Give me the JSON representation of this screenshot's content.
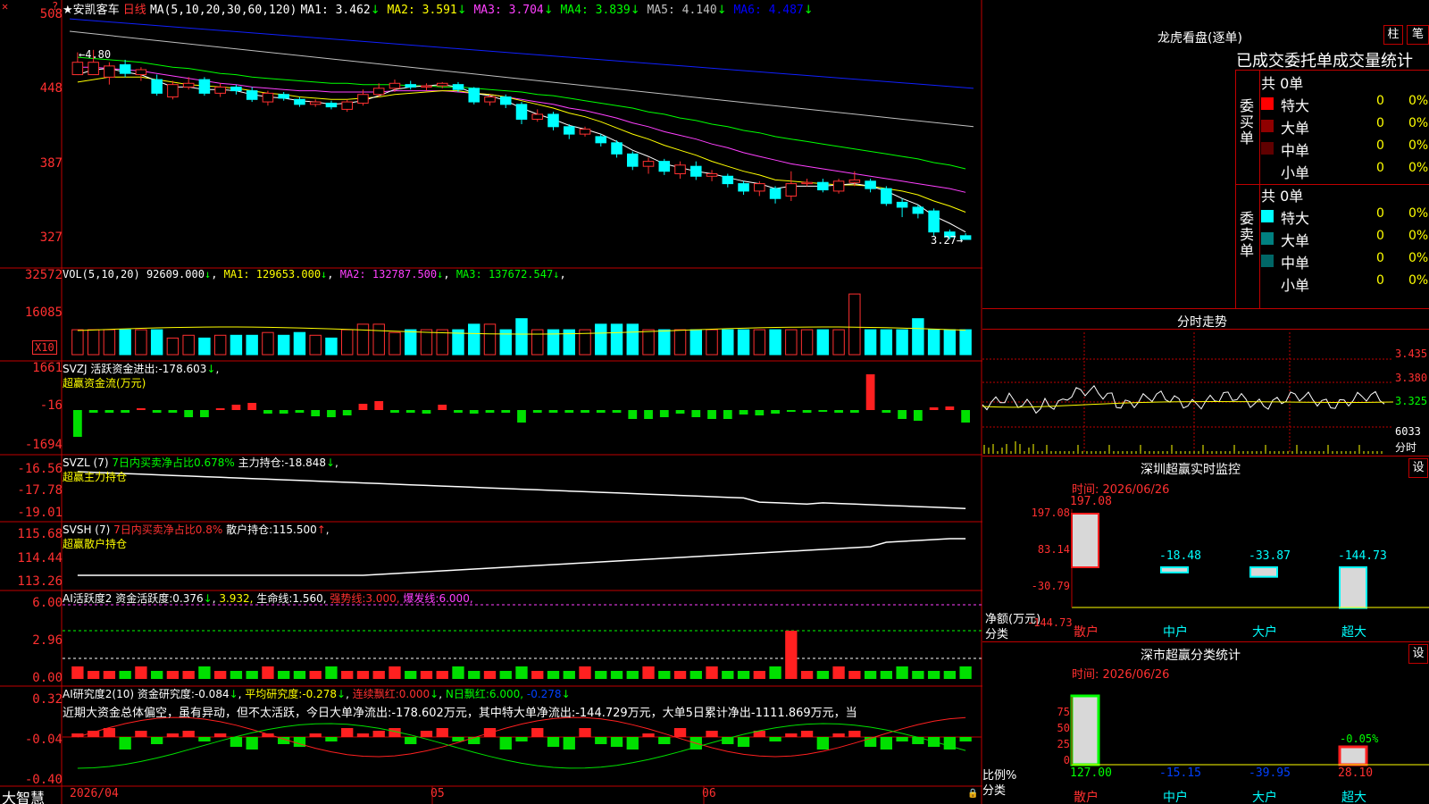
{
  "stock": {
    "name": "★安凯客车",
    "period": "日线",
    "ma_label": "MA(5,10,20,30,60,120)",
    "ma": [
      {
        "label": "MA1:",
        "value": "3.462",
        "arrow": "↓",
        "color": "#ffffff"
      },
      {
        "label": "MA2:",
        "value": "3.591",
        "arrow": "↓",
        "color": "#ffff00"
      },
      {
        "label": "MA3:",
        "value": "3.704",
        "arrow": "↓",
        "color": "#ff40ff"
      },
      {
        "label": "MA4:",
        "value": "3.839",
        "arrow": "↓",
        "color": "#00ff00"
      },
      {
        "label": "MA5:",
        "value": "4.140",
        "arrow": "↓",
        "color": "#c0c0c0"
      },
      {
        "label": "MA6:",
        "value": "4.487",
        "arrow": "↓",
        "color": "#0000ff"
      }
    ],
    "price_axis": [
      "508",
      "448",
      "387",
      "327"
    ],
    "high_label": "4.80",
    "low_label": "3.27",
    "candles": [
      [
        4.6,
        4.7,
        4.62,
        4.78
      ],
      [
        4.6,
        4.7,
        4.6,
        4.8
      ],
      [
        4.58,
        4.67,
        4.52,
        4.7
      ],
      [
        4.68,
        4.61,
        4.58,
        4.72
      ],
      [
        4.6,
        4.64,
        4.55,
        4.66
      ],
      [
        4.56,
        4.45,
        4.43,
        4.6
      ],
      [
        4.42,
        4.52,
        4.4,
        4.55
      ],
      [
        4.5,
        4.53,
        4.48,
        4.58
      ],
      [
        4.56,
        4.45,
        4.43,
        4.58
      ],
      [
        4.45,
        4.5,
        4.42,
        4.53
      ],
      [
        4.5,
        4.47,
        4.44,
        4.52
      ],
      [
        4.47,
        4.4,
        4.38,
        4.5
      ],
      [
        4.38,
        4.45,
        4.35,
        4.47
      ],
      [
        4.44,
        4.41,
        4.39,
        4.46
      ],
      [
        4.4,
        4.36,
        4.34,
        4.42
      ],
      [
        4.36,
        4.38,
        4.34,
        4.4
      ],
      [
        4.37,
        4.34,
        4.32,
        4.39
      ],
      [
        4.32,
        4.38,
        4.3,
        4.4
      ],
      [
        4.37,
        4.44,
        4.35,
        4.48
      ],
      [
        4.44,
        4.49,
        4.42,
        4.53
      ],
      [
        4.49,
        4.53,
        4.46,
        4.56
      ],
      [
        4.52,
        4.5,
        4.48,
        4.55
      ],
      [
        4.5,
        4.51,
        4.47,
        4.53
      ],
      [
        4.51,
        4.53,
        4.49,
        4.54
      ],
      [
        4.52,
        4.48,
        4.46,
        4.54
      ],
      [
        4.49,
        4.38,
        4.36,
        4.5
      ],
      [
        4.38,
        4.42,
        4.35,
        4.44
      ],
      [
        4.42,
        4.36,
        4.33,
        4.44
      ],
      [
        4.36,
        4.24,
        4.2,
        4.38
      ],
      [
        4.24,
        4.28,
        4.22,
        4.32
      ],
      [
        4.28,
        4.18,
        4.15,
        4.3
      ],
      [
        4.18,
        4.12,
        4.08,
        4.2
      ],
      [
        4.12,
        4.16,
        4.1,
        4.18
      ],
      [
        4.1,
        4.05,
        4.02,
        4.12
      ],
      [
        4.05,
        3.96,
        3.93,
        4.07
      ],
      [
        3.96,
        3.86,
        3.83,
        3.98
      ],
      [
        3.86,
        3.9,
        3.8,
        3.93
      ],
      [
        3.9,
        3.82,
        3.79,
        3.92
      ],
      [
        3.8,
        3.87,
        3.76,
        3.9
      ],
      [
        3.86,
        3.78,
        3.75,
        3.9
      ],
      [
        3.78,
        3.8,
        3.74,
        3.83
      ],
      [
        3.78,
        3.72,
        3.69,
        3.8
      ],
      [
        3.72,
        3.66,
        3.63,
        3.74
      ],
      [
        3.66,
        3.72,
        3.62,
        3.74
      ],
      [
        3.68,
        3.6,
        3.56,
        3.7
      ],
      [
        3.62,
        3.72,
        3.58,
        3.82
      ],
      [
        3.72,
        3.73,
        3.7,
        3.76
      ],
      [
        3.73,
        3.67,
        3.65,
        3.76
      ],
      [
        3.66,
        3.74,
        3.64,
        3.76
      ],
      [
        3.73,
        3.75,
        3.7,
        3.82
      ],
      [
        3.74,
        3.68,
        3.65,
        3.76
      ],
      [
        3.68,
        3.56,
        3.54,
        3.7
      ],
      [
        3.57,
        3.53,
        3.45,
        3.6
      ],
      [
        3.53,
        3.48,
        3.44,
        3.55
      ],
      [
        3.5,
        3.33,
        3.3,
        3.52
      ],
      [
        3.33,
        3.29,
        3.27,
        3.35
      ],
      [
        3.3,
        3.27,
        3.27,
        3.32
      ]
    ],
    "ma1": [
      4.6,
      4.64,
      4.65,
      4.62,
      4.6,
      4.55,
      4.5,
      4.5,
      4.48,
      4.48,
      4.47,
      4.44,
      4.42,
      4.41,
      4.39,
      4.38,
      4.36,
      4.37,
      4.39,
      4.43,
      4.48,
      4.5,
      4.51,
      4.52,
      4.5,
      4.45,
      4.43,
      4.39,
      4.33,
      4.28,
      4.24,
      4.19,
      4.16,
      4.12,
      4.06,
      3.99,
      3.94,
      3.88,
      3.85,
      3.82,
      3.8,
      3.77,
      3.74,
      3.72,
      3.68,
      3.7,
      3.7,
      3.7,
      3.71,
      3.72,
      3.7,
      3.66,
      3.6,
      3.55,
      3.46,
      3.4,
      3.33
    ],
    "ma2": [
      4.54,
      4.56,
      4.58,
      4.58,
      4.58,
      4.56,
      4.54,
      4.52,
      4.51,
      4.5,
      4.49,
      4.47,
      4.45,
      4.44,
      4.42,
      4.41,
      4.4,
      4.4,
      4.41,
      4.42,
      4.44,
      4.45,
      4.46,
      4.47,
      4.47,
      4.45,
      4.44,
      4.42,
      4.39,
      4.36,
      4.33,
      4.29,
      4.26,
      4.22,
      4.17,
      4.12,
      4.08,
      4.03,
      3.99,
      3.95,
      3.9,
      3.86,
      3.82,
      3.79,
      3.75,
      3.74,
      3.73,
      3.72,
      3.71,
      3.71,
      3.7,
      3.68,
      3.66,
      3.63,
      3.58,
      3.54,
      3.49
    ],
    "ma3": [
      4.66,
      4.66,
      4.65,
      4.64,
      4.63,
      4.61,
      4.59,
      4.57,
      4.55,
      4.53,
      4.52,
      4.5,
      4.49,
      4.48,
      4.47,
      4.47,
      4.46,
      4.46,
      4.46,
      4.46,
      4.47,
      4.47,
      4.47,
      4.47,
      4.46,
      4.45,
      4.44,
      4.42,
      4.4,
      4.38,
      4.36,
      4.33,
      4.31,
      4.28,
      4.25,
      4.21,
      4.18,
      4.14,
      4.11,
      4.08,
      4.04,
      4.01,
      3.97,
      3.94,
      3.91,
      3.88,
      3.86,
      3.84,
      3.82,
      3.8,
      3.78,
      3.76,
      3.74,
      3.72,
      3.7,
      3.68,
      3.65
    ],
    "ma4": [
      4.74,
      4.73,
      4.72,
      4.71,
      4.7,
      4.68,
      4.66,
      4.65,
      4.63,
      4.61,
      4.6,
      4.58,
      4.57,
      4.56,
      4.55,
      4.54,
      4.53,
      4.53,
      4.52,
      4.52,
      4.52,
      4.51,
      4.51,
      4.5,
      4.5,
      4.49,
      4.48,
      4.47,
      4.46,
      4.44,
      4.43,
      4.41,
      4.39,
      4.37,
      4.35,
      4.33,
      4.3,
      4.28,
      4.25,
      4.23,
      4.2,
      4.18,
      4.15,
      4.13,
      4.1,
      4.08,
      4.06,
      4.04,
      4.02,
      4.0,
      3.98,
      3.96,
      3.94,
      3.92,
      3.89,
      3.87,
      3.84
    ],
    "ma5_range": [
      4.95,
      4.18
    ],
    "ma6_range": [
      5.05,
      4.49
    ],
    "vol": {
      "label": "VOL(5,10,20)",
      "value": "92609.000",
      "ma1": "129653.000",
      "ma2": "132787.500",
      "ma3": "137672.547",
      "axis": [
        "32572",
        "16085"
      ],
      "unit": "X10",
      "bars": [
        9,
        9,
        9,
        9,
        9,
        9,
        6,
        7,
        6,
        7,
        7,
        7,
        8,
        7,
        8,
        7,
        6,
        9,
        11,
        11,
        8,
        9,
        9,
        9,
        9,
        11,
        11,
        9,
        13,
        9,
        9,
        9,
        9,
        11,
        11,
        11,
        9,
        9,
        9,
        9,
        9,
        9,
        9,
        9,
        9,
        9,
        9,
        9,
        9,
        9,
        9,
        9,
        9,
        13,
        9,
        9,
        9
      ]
    },
    "svzj": {
      "label": "SVZJ",
      "name": "活跃资金进出:",
      "value": "-178.603",
      "sub": "超赢资金流(万元)",
      "axis": [
        "1661",
        "-16",
        "-1694"
      ]
    },
    "svzl": {
      "label": "SVZL (7)",
      "t1": "7日内买卖净占比0.678%",
      "t2": "主力持仓:",
      "value": "-18.848",
      "sub": "超赢主力持仓",
      "axis": [
        "-16.56",
        "-17.78",
        "-19.01"
      ]
    },
    "svsh": {
      "label": "SVSH (7)",
      "t1": "7日内买卖净占比0.8%",
      "t2": "散户持仓:",
      "value": "115.500",
      "sub": "超赢散户持仓",
      "axis": [
        "115.68",
        "114.44",
        "113.26"
      ]
    },
    "ai1": {
      "label": "AI活跃度2",
      "t1": "资金活跃度:",
      "v1": "0.376",
      "v2": "3.932,",
      "t3": "生命线:",
      "v3": "1.560,",
      "t4": "强势线:",
      "v4": "3.000,",
      "t5": "爆发线:",
      "v5": "6.000,",
      "axis": [
        "6.00",
        "2.96",
        "0.00"
      ]
    },
    "ai2": {
      "label": "AI研究度2(10)",
      "t1": "资金研究度:",
      "v1": "-0.084",
      "t2": "平均研究度:",
      "v2": "-0.278",
      "t3": "连续飘红:",
      "v3": "0.000",
      "t4": "N日飘红:",
      "v4": "6.000,",
      "v5": "-0.278",
      "axis": [
        "0.32",
        "-0.04",
        "-0.40"
      ],
      "text": "近期大资金总体偏空，虽有异动，但不太活跃，今日大单净流出:-178.602万元，其中特大单净流出:-144.729万元，大单5日累计净出-1111.869万元，当"
    },
    "bottom": {
      "brand": "大智慧",
      "dates": [
        "2026/04",
        "05",
        "06"
      ]
    }
  },
  "right": {
    "lhkp": {
      "title": "龙虎看盘(逐单)",
      "btn1": "柱",
      "btn2": "笔",
      "header": "已成交委托单成交量统计",
      "buy": {
        "side": "委买单",
        "count": "共 0单",
        "rows": [
          {
            "k": "特大",
            "v": "0",
            "p": "0%",
            "c": "#ff0000"
          },
          {
            "k": "大单",
            "v": "0",
            "p": "0%",
            "c": "#900000"
          },
          {
            "k": "中单",
            "v": "0",
            "p": "0%",
            "c": "#600000"
          },
          {
            "k": "小单",
            "v": "0",
            "p": "0%",
            "c": "#000000"
          }
        ]
      },
      "sell": {
        "side": "委卖单",
        "count": "共 0单",
        "rows": [
          {
            "k": "特大",
            "v": "0",
            "p": "0%",
            "c": "#00ffff"
          },
          {
            "k": "大单",
            "v": "0",
            "p": "0%",
            "c": "#008080"
          },
          {
            "k": "中单",
            "v": "0",
            "p": "0%",
            "c": "#006666"
          },
          {
            "k": "小单",
            "v": "0",
            "p": "0%",
            "c": "#000000"
          }
        ]
      }
    },
    "fs": {
      "title": "分时走势",
      "axis": [
        "3.435",
        "3.380",
        "3.325",
        "6033",
        "分时"
      ]
    },
    "monitor": {
      "title": "深圳超赢实时监控",
      "btn": "设",
      "time": "时间: 2026/06/26",
      "axis": [
        "197.08",
        "83.14",
        "-30.79",
        "-144.73"
      ],
      "ylabel": "净额(万元)",
      "xlabel": "分类",
      "cats": [
        "散户",
        "中户",
        "大户",
        "超大"
      ],
      "values": [
        "197.08",
        "-18.48",
        "-33.87",
        "-144.73"
      ]
    },
    "stats": {
      "title": "深市超赢分类统计",
      "btn": "设",
      "time": "时间: 2026/06/26",
      "axis": [
        "75",
        "50",
        "25",
        "0"
      ],
      "ylabel": "比例%",
      "xlabel": "分类",
      "cats": [
        "散户",
        "中户",
        "大户",
        "超大"
      ],
      "values": [
        "127.00",
        "-15.15",
        "-39.95",
        "28.10"
      ],
      "top": "-0.05%"
    }
  }
}
